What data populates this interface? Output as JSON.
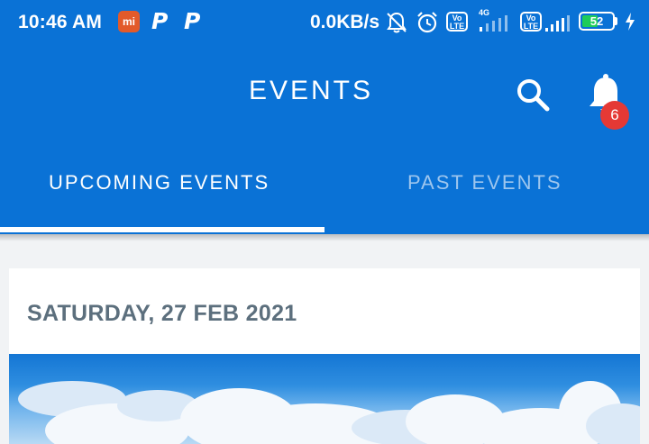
{
  "status_bar": {
    "time": "10:46 AM",
    "mi_label": "mi",
    "p_icon": "P",
    "net_speed": "0.0KB/s",
    "volte_label": "Vo\nLTE",
    "network_type": "4G",
    "battery_level": "52",
    "battery_fraction": 0.52,
    "icons": [
      "mi-app-icon",
      "p-app-icon",
      "p-app-icon",
      "notifications-off-icon",
      "alarm-icon",
      "volte-icon",
      "signal-4g-icon",
      "volte-icon",
      "signal-icon",
      "battery-icon",
      "charging-bolt-icon"
    ]
  },
  "appbar": {
    "title": "EVENTS",
    "search_icon": "search-icon",
    "bell_icon": "bell-icon",
    "notification_count": "6"
  },
  "tabs": [
    {
      "label": "UPCOMING EVENTS",
      "active": true
    },
    {
      "label": "PAST EVENTS",
      "active": false
    }
  ],
  "content": {
    "date_header": "SATURDAY, 27 FEB 2021",
    "image_subject": "sky-with-clouds"
  },
  "colors": {
    "primary": "#0a72d6",
    "badge": "#e53935",
    "inactive_tab": "#9ec6ee",
    "date_text": "#5c6f7d"
  }
}
